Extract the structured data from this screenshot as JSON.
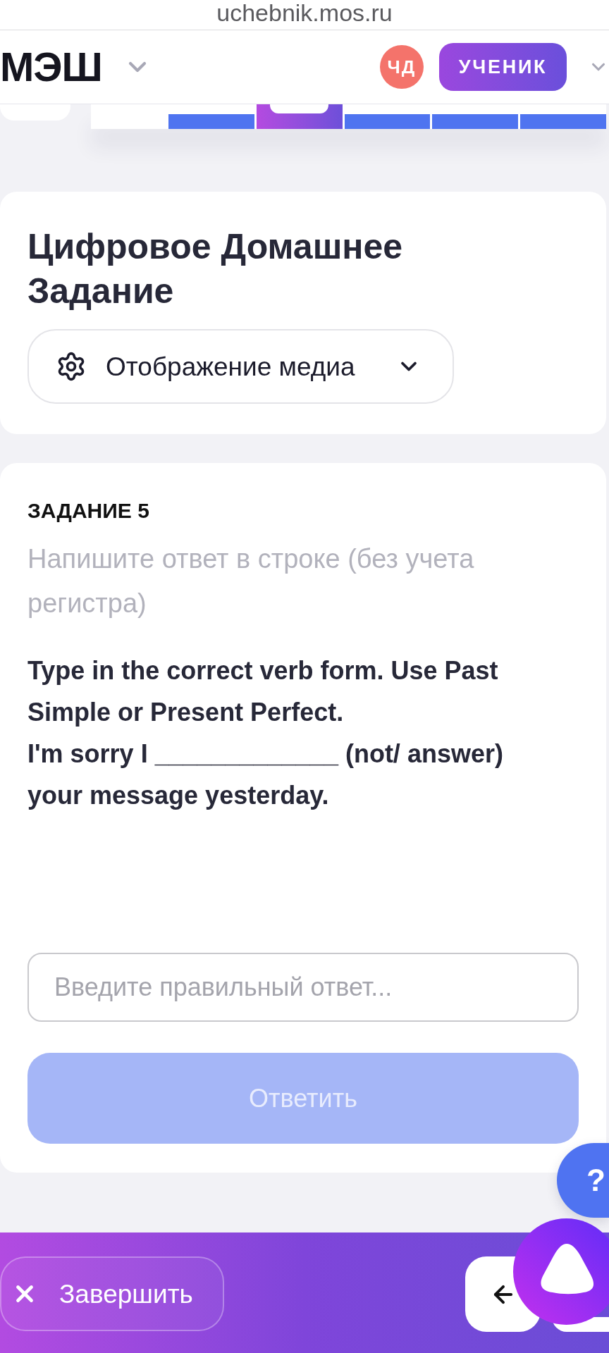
{
  "browser": {
    "url": "uchebnik.mos.ru"
  },
  "header": {
    "logo": "МЭШ",
    "avatar_initials": "ЧД",
    "role": "УЧЕНИК"
  },
  "question_tabs": [
    {
      "selected": false
    },
    {
      "selected": true
    },
    {
      "selected": false
    },
    {
      "selected": false
    },
    {
      "selected": false
    }
  ],
  "title_card": {
    "title": "Цифровое Домашнее Задание",
    "media_button": "Отображение медиа"
  },
  "task": {
    "number": "ЗАДАНИЕ 5",
    "hint": "Напишите ответ в строке (без учета регистра)",
    "instruction": [
      "Type in the correct verb form. Use Past Simple or Present Perfect.",
      "I'm sorry I _____________ (not/ answer) your message yesterday."
    ],
    "answer": {
      "placeholder": "Введите правильный ответ..."
    },
    "submit": {
      "label": "Ответить",
      "disabled": true
    }
  },
  "help_button": {
    "label": "?"
  },
  "bottom_bar": {
    "finish": "Завершить"
  }
}
